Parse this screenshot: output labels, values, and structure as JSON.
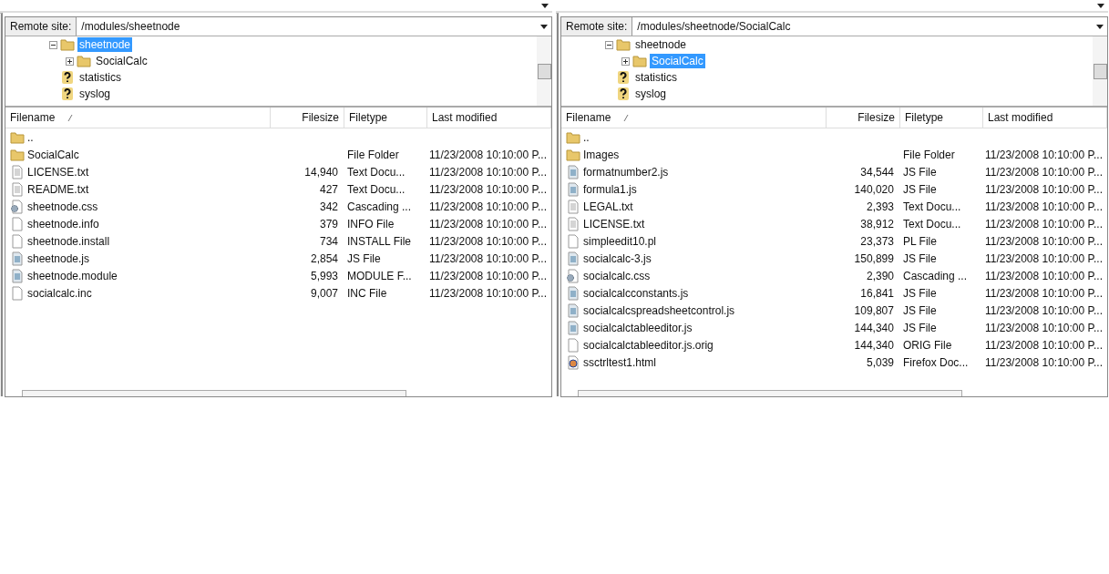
{
  "panes": [
    {
      "remote_site_label": "Remote site:",
      "path": "/modules/sheetnode",
      "tree": [
        {
          "label": "sheetnode",
          "kind": "folder",
          "expanded": true,
          "selected": true,
          "children": [
            {
              "label": "SocialCalc",
              "kind": "folder",
              "expanded": false,
              "selected": false
            }
          ]
        },
        {
          "label": "statistics",
          "kind": "unknown",
          "selected": false
        },
        {
          "label": "syslog",
          "kind": "unknown",
          "selected": false
        }
      ],
      "columns": [
        "Filename",
        "Filesize",
        "Filetype",
        "Last modified"
      ],
      "rows": [
        {
          "name": "..",
          "kind": "folder",
          "size": "",
          "type": "",
          "modified": ""
        },
        {
          "name": "SocialCalc",
          "kind": "folder",
          "size": "",
          "type": "File Folder",
          "modified": "11/23/2008 10:10:00 P..."
        },
        {
          "name": "LICENSE.txt",
          "kind": "text",
          "size": "14,940",
          "type": "Text Docu...",
          "modified": "11/23/2008 10:10:00 P..."
        },
        {
          "name": "README.txt",
          "kind": "text",
          "size": "427",
          "type": "Text Docu...",
          "modified": "11/23/2008 10:10:00 P..."
        },
        {
          "name": "sheetnode.css",
          "kind": "gear",
          "size": "342",
          "type": "Cascading ...",
          "modified": "11/23/2008 10:10:00 P..."
        },
        {
          "name": "sheetnode.info",
          "kind": "blank",
          "size": "379",
          "type": "INFO File",
          "modified": "11/23/2008 10:10:00 P..."
        },
        {
          "name": "sheetnode.install",
          "kind": "blank",
          "size": "734",
          "type": "INSTALL File",
          "modified": "11/23/2008 10:10:00 P..."
        },
        {
          "name": "sheetnode.js",
          "kind": "script",
          "size": "2,854",
          "type": "JS File",
          "modified": "11/23/2008 10:10:00 P..."
        },
        {
          "name": "sheetnode.module",
          "kind": "script",
          "size": "5,993",
          "type": "MODULE F...",
          "modified": "11/23/2008 10:10:00 P..."
        },
        {
          "name": "socialcalc.inc",
          "kind": "blank",
          "size": "9,007",
          "type": "INC File",
          "modified": "11/23/2008 10:10:00 P..."
        }
      ]
    },
    {
      "remote_site_label": "Remote site:",
      "path": "/modules/sheetnode/SocialCalc",
      "tree": [
        {
          "label": "sheetnode",
          "kind": "folder",
          "expanded": true,
          "selected": false,
          "children": [
            {
              "label": "SocialCalc",
              "kind": "folder",
              "expanded": false,
              "selected": true
            }
          ]
        },
        {
          "label": "statistics",
          "kind": "unknown",
          "selected": false
        },
        {
          "label": "syslog",
          "kind": "unknown",
          "selected": false
        }
      ],
      "columns": [
        "Filename",
        "Filesize",
        "Filetype",
        "Last modified"
      ],
      "rows": [
        {
          "name": "..",
          "kind": "folder",
          "size": "",
          "type": "",
          "modified": ""
        },
        {
          "name": "Images",
          "kind": "folder",
          "size": "",
          "type": "File Folder",
          "modified": "11/23/2008 10:10:00 P..."
        },
        {
          "name": "formatnumber2.js",
          "kind": "script",
          "size": "34,544",
          "type": "JS File",
          "modified": "11/23/2008 10:10:00 P..."
        },
        {
          "name": "formula1.js",
          "kind": "script",
          "size": "140,020",
          "type": "JS File",
          "modified": "11/23/2008 10:10:00 P..."
        },
        {
          "name": "LEGAL.txt",
          "kind": "text",
          "size": "2,393",
          "type": "Text Docu...",
          "modified": "11/23/2008 10:10:00 P..."
        },
        {
          "name": "LICENSE.txt",
          "kind": "text",
          "size": "38,912",
          "type": "Text Docu...",
          "modified": "11/23/2008 10:10:00 P..."
        },
        {
          "name": "simpleedit10.pl",
          "kind": "blank",
          "size": "23,373",
          "type": "PL File",
          "modified": "11/23/2008 10:10:00 P..."
        },
        {
          "name": "socialcalc-3.js",
          "kind": "script",
          "size": "150,899",
          "type": "JS File",
          "modified": "11/23/2008 10:10:00 P..."
        },
        {
          "name": "socialcalc.css",
          "kind": "gear",
          "size": "2,390",
          "type": "Cascading ...",
          "modified": "11/23/2008 10:10:00 P..."
        },
        {
          "name": "socialcalcconstants.js",
          "kind": "script",
          "size": "16,841",
          "type": "JS File",
          "modified": "11/23/2008 10:10:00 P..."
        },
        {
          "name": "socialcalcspreadsheetcontrol.js",
          "kind": "script",
          "size": "109,807",
          "type": "JS File",
          "modified": "11/23/2008 10:10:00 P..."
        },
        {
          "name": "socialcalctableeditor.js",
          "kind": "script",
          "size": "144,340",
          "type": "JS File",
          "modified": "11/23/2008 10:10:00 P..."
        },
        {
          "name": "socialcalctableeditor.js.orig",
          "kind": "blank",
          "size": "144,340",
          "type": "ORIG File",
          "modified": "11/23/2008 10:10:00 P..."
        },
        {
          "name": "ssctrltest1.html",
          "kind": "browser",
          "size": "5,039",
          "type": "Firefox Doc...",
          "modified": "11/23/2008 10:10:00 P..."
        }
      ]
    }
  ]
}
